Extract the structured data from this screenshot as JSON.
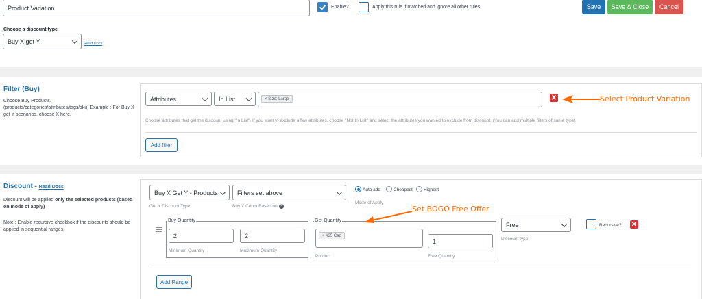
{
  "header": {
    "rule_title_value": "Product Variation",
    "enable_label": "Enable?",
    "apply_rule_label": "Apply this rule if matched and ignore all other rules",
    "save_label": "Save",
    "save_close_label": "Save & Close",
    "cancel_label": "Cancel",
    "enable_checked": true,
    "apply_rule_checked": false
  },
  "discount_type": {
    "label": "Choose a discount type",
    "value": "Buy X get Y",
    "read_docs": "Read Docs"
  },
  "filter": {
    "heading": "Filter (Buy)",
    "description": "Choose Buy Products. (products/categories/attributes/tags/sku) Example : For Buy X get Y scenarios, choose X here.",
    "type_value": "Attributes",
    "condition_value": "In List",
    "tag": "× Size: Large",
    "help": "Choose attributes that get the discount using \"In List\". If you want to exclude a few attributes, choose \"Not In List\" and select the attributes you wanted to exclude from discount. (You can add multiple filters of same type)",
    "add_filter": "Add filter"
  },
  "discount": {
    "heading": "Discount - ",
    "read_docs": "Read Docs",
    "desc_prefix": "Discount will be applied ",
    "desc_bold": "only the selected products (based on mode of apply)",
    "note": "Note : Enable recursive checkbox if the discounts should be applied in sequential ranges.",
    "get_y_type_value": "Buy X Get Y - Products",
    "get_y_type_label": "Get Y Discount Type",
    "count_based_value": "Filters set above",
    "count_based_label": "Buy X Count Based on",
    "modes": [
      "Auto add",
      "Cheapest",
      "Highest"
    ],
    "mode_label": "Mode of Apply",
    "buy_quantity_legend": "Buy Quantity",
    "min_qty_value": "2",
    "max_qty_value": "2",
    "min_qty_label": "Minimum Quantity",
    "max_qty_label": "Maximum Quantity",
    "get_quantity_legend": "Get Quantity",
    "product_tag": "× #35 Cap",
    "product_label": "Product",
    "free_qty_value": "1",
    "free_qty_label": "Free Quantity",
    "discount_type_value": "Free",
    "discount_type_label": "Discount type",
    "recursive_label": "Recursive?",
    "add_range": "Add Range"
  },
  "annotations": {
    "select_variation": "Select Product Variation",
    "set_bogo": "Set BOGO Free Offer"
  },
  "colors": {
    "primary": "#2271b1",
    "success": "#5cb85c",
    "danger": "#d9534f",
    "annotation": "#ff6a00"
  }
}
